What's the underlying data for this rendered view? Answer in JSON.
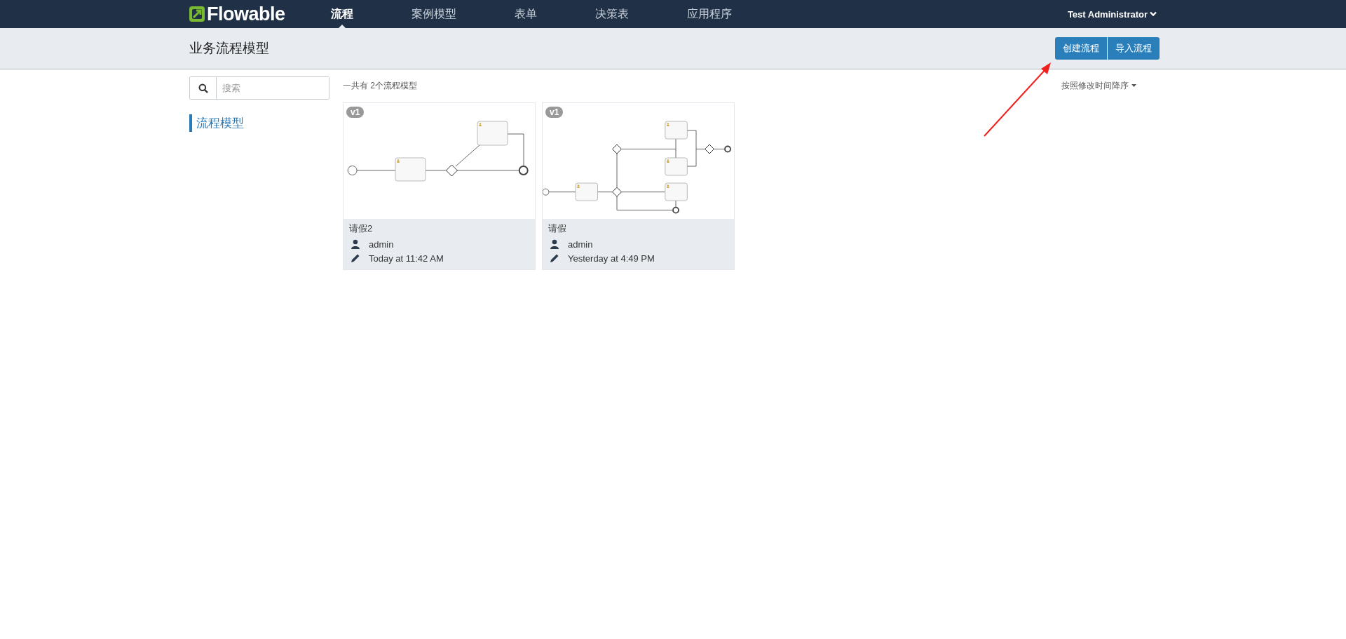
{
  "header": {
    "logo": "Flowable",
    "nav": [
      {
        "label": "流程",
        "selected": true
      },
      {
        "label": "案例模型",
        "selected": false
      },
      {
        "label": "表单",
        "selected": false
      },
      {
        "label": "决策表",
        "selected": false
      },
      {
        "label": "应用程序",
        "selected": false
      }
    ],
    "user": "Test Administrator"
  },
  "toolbar": {
    "title": "业务流程模型",
    "buttons": [
      "创建流程",
      "导入流程"
    ]
  },
  "search": {
    "placeholder": "搜索"
  },
  "sidebar": {
    "items": [
      {
        "label": "流程模型",
        "selected": true
      }
    ]
  },
  "summary": "一共有 2个流程模型",
  "sort": "按照修改时间降序",
  "models": [
    {
      "kind": "branch",
      "version": "v1",
      "name": "请假2",
      "author": "admin",
      "modified": "Today at 11:42 AM"
    },
    {
      "kind": "parallel",
      "version": "v1",
      "name": "请假",
      "author": "admin",
      "modified": "Yesterday at 4:49 PM"
    }
  ]
}
